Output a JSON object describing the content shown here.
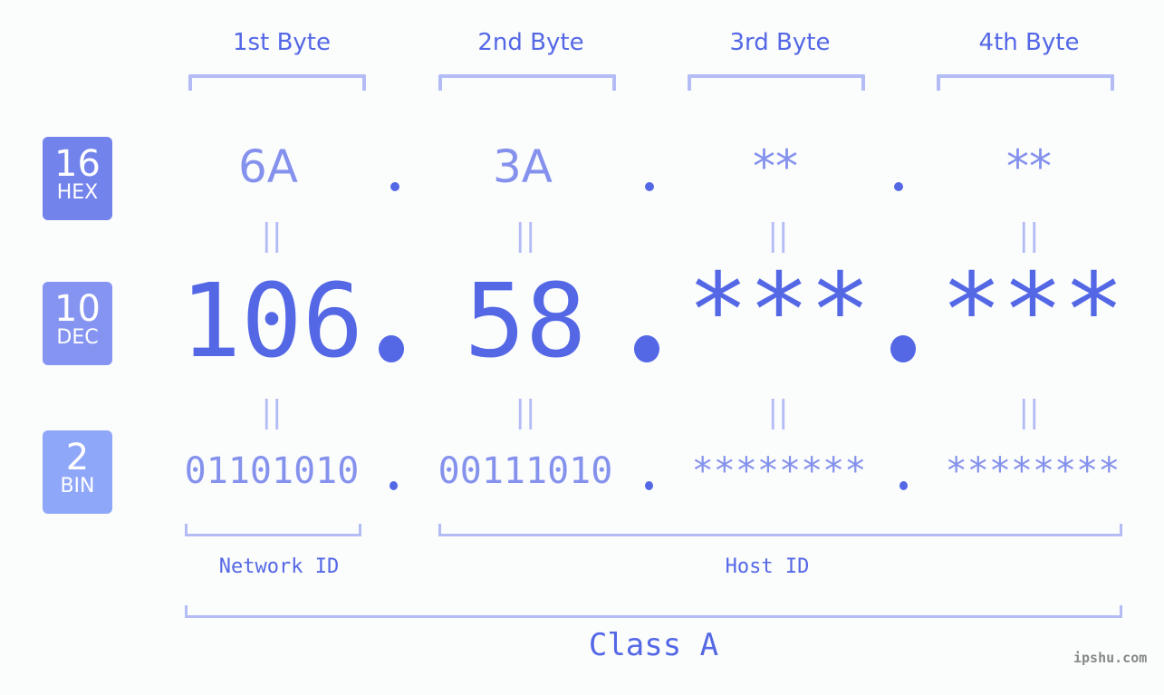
{
  "bytes": [
    {
      "header": "1st Byte",
      "hex": "6A",
      "dec": "106",
      "bin": "01101010"
    },
    {
      "header": "2nd Byte",
      "hex": "3A",
      "dec": "58",
      "bin": "00111010"
    },
    {
      "header": "3rd Byte",
      "hex": "**",
      "dec": "***",
      "bin": "********"
    },
    {
      "header": "4th Byte",
      "hex": "**",
      "dec": "***",
      "bin": "********"
    }
  ],
  "equals_glyph": "||",
  "bases": [
    {
      "num": "16",
      "label": "HEX",
      "color": "#7383ec"
    },
    {
      "num": "10",
      "label": "DEC",
      "color": "#8594f1"
    },
    {
      "num": "2",
      "label": "BIN",
      "color": "#8fa7f8"
    }
  ],
  "network_label": "Network ID",
  "host_label": "Host ID",
  "class_label": "Class A",
  "watermark": "ipshu.com",
  "colors": {
    "primary": "#5468e6",
    "secondary": "#8592ed",
    "bracket": "#b3bcf5"
  }
}
